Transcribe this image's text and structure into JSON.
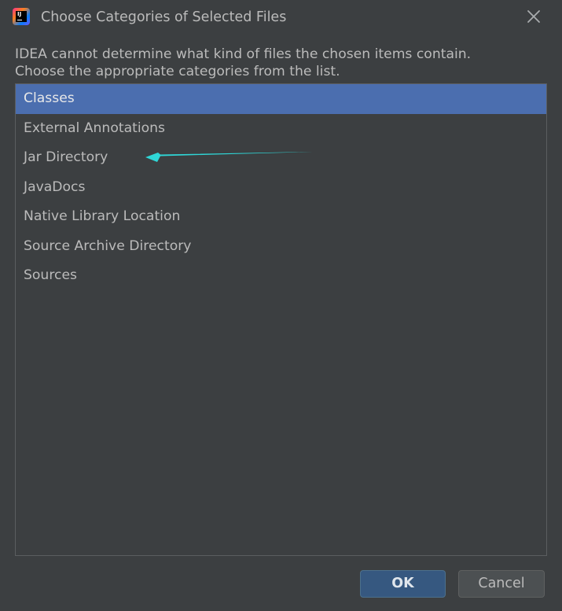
{
  "window": {
    "title": "Choose Categories of Selected Files"
  },
  "description": {
    "line1": "IDEA cannot determine what kind of files the chosen items contain.",
    "line2": "Choose the appropriate categories from the list."
  },
  "categories": {
    "items": [
      {
        "label": "Classes",
        "selected": true
      },
      {
        "label": "External Annotations",
        "selected": false
      },
      {
        "label": "Jar Directory",
        "selected": false
      },
      {
        "label": "JavaDocs",
        "selected": false
      },
      {
        "label": "Native Library Location",
        "selected": false
      },
      {
        "label": "Source Archive Directory",
        "selected": false
      },
      {
        "label": "Sources",
        "selected": false
      }
    ]
  },
  "annotation": {
    "arrow_color": "#2fd6d6",
    "points_to": "Jar Directory"
  },
  "buttons": {
    "ok_label": "OK",
    "cancel_label": "Cancel"
  },
  "colors": {
    "background": "#3c3f41",
    "selection": "#4b6eaf",
    "ok_button": "#365880",
    "text": "#bbbbbb"
  },
  "icons": {
    "app": "intellij-idea-icon",
    "close": "close-icon"
  }
}
